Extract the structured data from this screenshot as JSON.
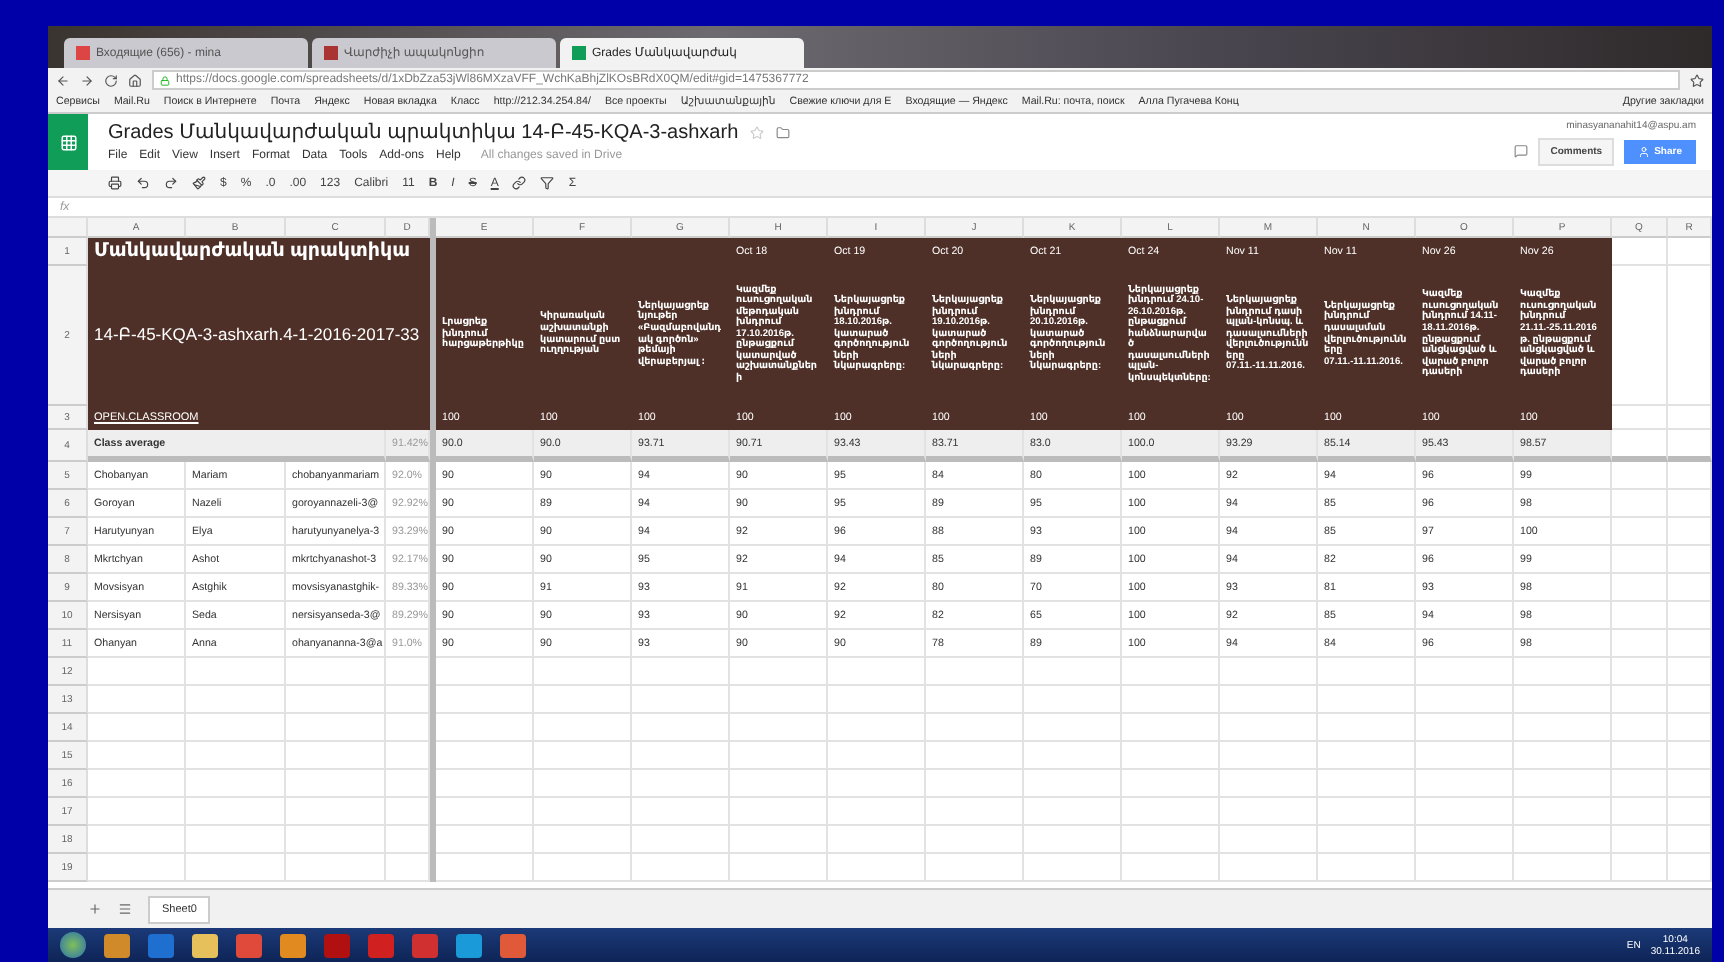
{
  "browser": {
    "tabs": [
      {
        "label": "Входящие (656) - mina",
        "selected": false
      },
      {
        "label": "Վարժիչի ապակոնցիո",
        "selected": false
      },
      {
        "label": "Grades Մանկավարժակ",
        "selected": true
      }
    ],
    "address": "https://docs.google.com/spreadsheets/d/1xDbZza53jWl86MXzaVFF_WchKaBhjZlKOsBRdX0QM/edit#gid=1475367772",
    "bookmarks": [
      "Сервисы",
      "Mail.Ru",
      "Поиск в Интернете",
      "Почта",
      "Яндекс",
      "Новая вкладка",
      "Класс",
      "http://212.34.254.84/",
      "Все проекты",
      "Աշխատանքային",
      "Свежие ключи для E",
      "Входящие — Яндекс",
      "Mail.Ru: почта, поиск",
      "Алла Пугачева Конц"
    ],
    "other_bookmarks": "Другие закладки"
  },
  "doc": {
    "title": "Grades Մանկավարժական պրակտիկա 14-Բ-45-KQA-3-ashxarh",
    "menu": [
      "File",
      "Edit",
      "View",
      "Insert",
      "Format",
      "Data",
      "Tools",
      "Add-ons",
      "Help"
    ],
    "save_status": "All changes saved in Drive",
    "account": "minasyananahit14@aspu.am",
    "comments_button": "Comments",
    "share_button": "Share"
  },
  "toolbar": {
    "texts": [
      "$",
      "%",
      ".0",
      ".00",
      "123",
      "Calibri",
      "11"
    ],
    "styles": [
      "B",
      "I",
      "S",
      "A"
    ],
    "sum": "Σ"
  },
  "formula_bar": {
    "label": "fx"
  },
  "sheet": {
    "columns": [
      "A",
      "B",
      "C",
      "D",
      "E",
      "F",
      "G",
      "H",
      "I",
      "J",
      "K",
      "L",
      "M",
      "N",
      "O",
      "P",
      "Q",
      "R"
    ],
    "row_numbers": [
      "1",
      "2",
      "3",
      "4",
      "5",
      "6",
      "7",
      "8",
      "9",
      "10",
      "11",
      "12",
      "13",
      "14",
      "15",
      "16",
      "17",
      "18",
      "19"
    ],
    "title": "Մանկավարժական պրակտիկա",
    "code": "14-Բ-45-KQA-3-ashxarh.4-1-2016-2017-33",
    "link": "OPEN.CLASSROOM",
    "assignments": [
      {
        "text": "Լրացրեք խնդրում հարցաթերթիկը",
        "points": "100"
      },
      {
        "text": "Կիրառական աշխատանքի կատարում ըստ ուղղության",
        "points": "100"
      },
      {
        "text": "Ներկայացրեք նյութեր «Բազմաբովանդակ գործոն» թեմայի վերաբերյալ ։",
        "points": "100"
      },
      {
        "date": "Oct 18",
        "text": "Կազմեք ուսուցողական մեթոդական խնդրում 17.10.2016թ. ընթացքում կատարված աշխատանքների",
        "points": "100"
      },
      {
        "date": "Oct 19",
        "text": "Ներկայացրեք խնդրում 18.10.2016թ. կատարած գործողություն ների նկարագրերը:",
        "points": "100"
      },
      {
        "date": "Oct 20",
        "text": "Ներկայացրեք խնդրում 19.10.2016թ. կատարած գործողություն ների նկարագրերը:",
        "points": "100"
      },
      {
        "date": "Oct 21",
        "text": "Ներկայացրեք խնդրում 20.10.2016թ. կատարած գործողություն ների նկարագրերը:",
        "points": "100"
      },
      {
        "date": "Oct 24",
        "text": "Ներկայացրեք խնդրում 24.10-26.10.2016թ. ընթացքում հանձնարարված դասալսումների պլան-կոնսպեկտները:",
        "points": "100"
      },
      {
        "date": "Nov 11",
        "text": "Ներկայացրեք խնդրում դասի պլան-կոնսպ. և դասալսումների վերլուծությունները 07.11.-11.11.2016.",
        "points": "100"
      },
      {
        "date": "Nov 11",
        "text": "Ներկայացրեք խնդրում դասալսման վերլուծությունները 07.11.-11.11.2016.",
        "points": "100"
      },
      {
        "date": "Nov 26",
        "text": "Կազմեք ուսուցողական խնդրում 14.11-18.11.2016թ. ընթացքում անցկացված և վարած բոլոր դասերի",
        "points": "100"
      },
      {
        "date": "Nov 26",
        "text": "Կազմեք ուսուցողական խնդրում 21.11.-25.11.2016թ. ընթացքում անցկացված և վարած բոլոր դասերի",
        "points": "100"
      }
    ],
    "class_average": {
      "label": "Class average",
      "percent": "91.42%",
      "values": [
        "90.0",
        "90.0",
        "93.71",
        "90.71",
        "93.43",
        "83.71",
        "83.0",
        "100.0",
        "93.29",
        "85.14",
        "95.43",
        "98.57"
      ]
    },
    "students": [
      {
        "last": "Chobanyan",
        "first": "Mariam",
        "email": "chobanyanmariam",
        "percent": "92.0%",
        "scores": [
          "90",
          "90",
          "94",
          "90",
          "95",
          "84",
          "80",
          "100",
          "92",
          "94",
          "96",
          "99"
        ]
      },
      {
        "last": "Goroyan",
        "first": "Nazeli",
        "email": "goroyannazeli-3@",
        "percent": "92.92%",
        "scores": [
          "90",
          "89",
          "94",
          "90",
          "95",
          "89",
          "95",
          "100",
          "94",
          "85",
          "96",
          "98"
        ]
      },
      {
        "last": "Harutyunyan",
        "first": "Elya",
        "email": "harutyunyanelya-3",
        "percent": "93.29%",
        "scores": [
          "90",
          "90",
          "94",
          "92",
          "96",
          "88",
          "93",
          "100",
          "94",
          "85",
          "97",
          "100"
        ]
      },
      {
        "last": "Mkrtchyan",
        "first": "Ashot",
        "email": "mkrtchyanashot-3",
        "percent": "92.17%",
        "scores": [
          "90",
          "90",
          "95",
          "92",
          "94",
          "85",
          "89",
          "100",
          "94",
          "82",
          "96",
          "99"
        ]
      },
      {
        "last": "Movsisyan",
        "first": "Astghik",
        "email": "movsisyanastghik-",
        "percent": "89.33%",
        "scores": [
          "90",
          "91",
          "93",
          "91",
          "92",
          "80",
          "70",
          "100",
          "93",
          "81",
          "93",
          "98"
        ]
      },
      {
        "last": "Nersisyan",
        "first": "Seda",
        "email": "nersisyanseda-3@",
        "percent": "89.29%",
        "scores": [
          "90",
          "90",
          "93",
          "90",
          "92",
          "82",
          "65",
          "100",
          "92",
          "85",
          "94",
          "98"
        ]
      },
      {
        "last": "Ohanyan",
        "first": "Anna",
        "email": "ohanyananna-3@a",
        "percent": "91.0%",
        "scores": [
          "90",
          "90",
          "93",
          "90",
          "90",
          "78",
          "89",
          "100",
          "94",
          "84",
          "96",
          "98"
        ]
      }
    ]
  },
  "sheet_tabs": [
    {
      "label": "Sheet0",
      "selected": true
    }
  ],
  "taskbar": {
    "language": "EN",
    "time": "10:04",
    "date": "30.11.2016"
  }
}
